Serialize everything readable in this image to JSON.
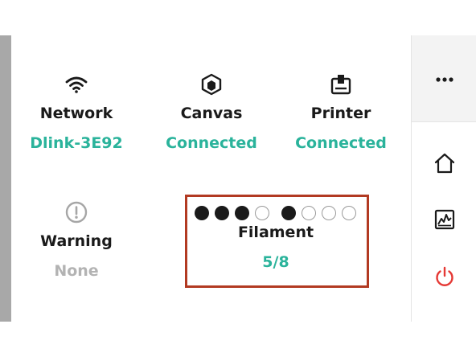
{
  "status_tiles": [
    {
      "label": "Network",
      "value": "Dlink-3E92",
      "icon": "wifi-icon"
    },
    {
      "label": "Canvas",
      "value": "Connected",
      "icon": "canvas-cube-icon"
    },
    {
      "label": "Printer",
      "value": "Connected",
      "icon": "printer-icon"
    },
    {
      "label": "Warning",
      "value": "None",
      "icon": "warning-icon"
    }
  ],
  "filament": {
    "label": "Filament",
    "value": "5/8",
    "slots_filled": [
      true,
      true,
      true,
      false,
      true,
      false,
      false,
      false
    ]
  },
  "side_rail": {
    "more": "more-options-icon",
    "home": "home-icon",
    "activity": "activity-chart-icon",
    "power": "power-icon"
  },
  "colors": {
    "accent": "#2ab39b",
    "muted": "#b3b3b3",
    "highlight": "#b23a22",
    "power": "#e53935"
  }
}
